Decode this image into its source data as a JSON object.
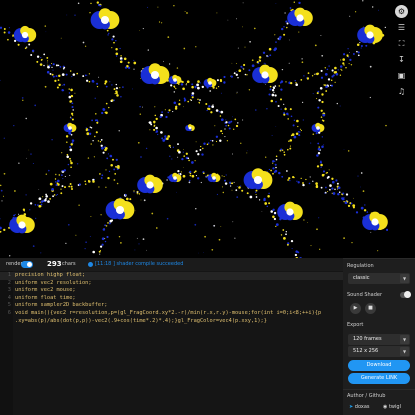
{
  "fractal": {
    "colors": {
      "background": "#000000",
      "blue": "#1a2fd6",
      "yellow": "#f4e01c",
      "white": "#ffffff"
    }
  },
  "icon_strip": {
    "icons": [
      "settings-icon",
      "tune-icon",
      "fullscreen-icon",
      "download-icon",
      "image-icon",
      "audio-icon"
    ]
  },
  "toolbar": {
    "render_label": "render",
    "render_on": true,
    "char_count": "293",
    "chars_label": "chars",
    "status_text": "[11:18 ] shader compile succeeded",
    "status_color": "#1e88e5"
  },
  "editor": {
    "lines": [
      "precision highp float;",
      "uniform vec2 resolution;",
      "uniform vec2 mouse;",
      "uniform float time;",
      "uniform sampler2D backbuffer;",
      "void main(){vec2 r=resolution,p=(gl_FragCoord.xy*2.-r)/min(r.x,r.y)-mouse;for(int i=0;i<8;++i){p",
      ".xy=abs(p)/abs(dot(p,p))-vec2(.9+cos(time*.2)*.4);}gl_FragColor=vec4(p.xxy,1);}"
    ],
    "line_numbers": [
      "1",
      "2",
      "3",
      "4",
      "5",
      "6",
      ""
    ]
  },
  "panel": {
    "regulation": {
      "title": "Regulation",
      "selected": "classic"
    },
    "sound": {
      "title": "Sound Shader",
      "enabled": false
    },
    "export": {
      "title": "Export",
      "frames": "120 frames",
      "size": "512 x 256",
      "download_label": "Download",
      "link_label": "Generate LINK"
    },
    "author": {
      "title": "Author / Github",
      "twitter": "doxas",
      "github": "twigl"
    },
    "accent_color": "#2196f3"
  }
}
